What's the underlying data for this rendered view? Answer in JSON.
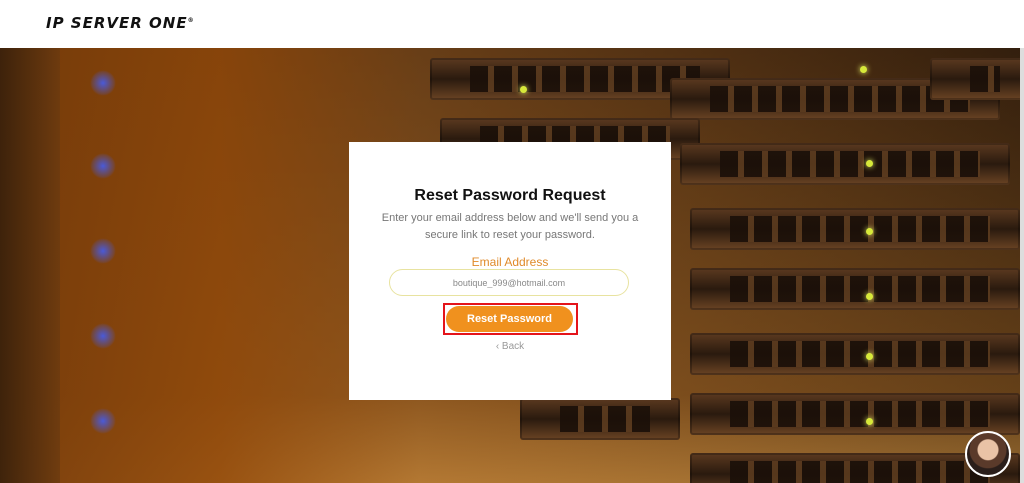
{
  "header": {
    "logo_text": "IP SERVER ONE",
    "logo_mark": "®"
  },
  "card": {
    "title": "Reset Password Request",
    "description": "Enter your email address below and we'll send you a secure link to reset your password.",
    "email_label": "Email Address",
    "email_value": "boutique_999@hotmail.com",
    "reset_button_label": "Reset Password",
    "back_label": "‹ Back"
  },
  "colors": {
    "accent": "#f0911e",
    "label": "#e08a2a",
    "highlight": "#e4141b"
  },
  "icons": {
    "back": "chevron-left-icon",
    "avatar": "support-avatar"
  }
}
